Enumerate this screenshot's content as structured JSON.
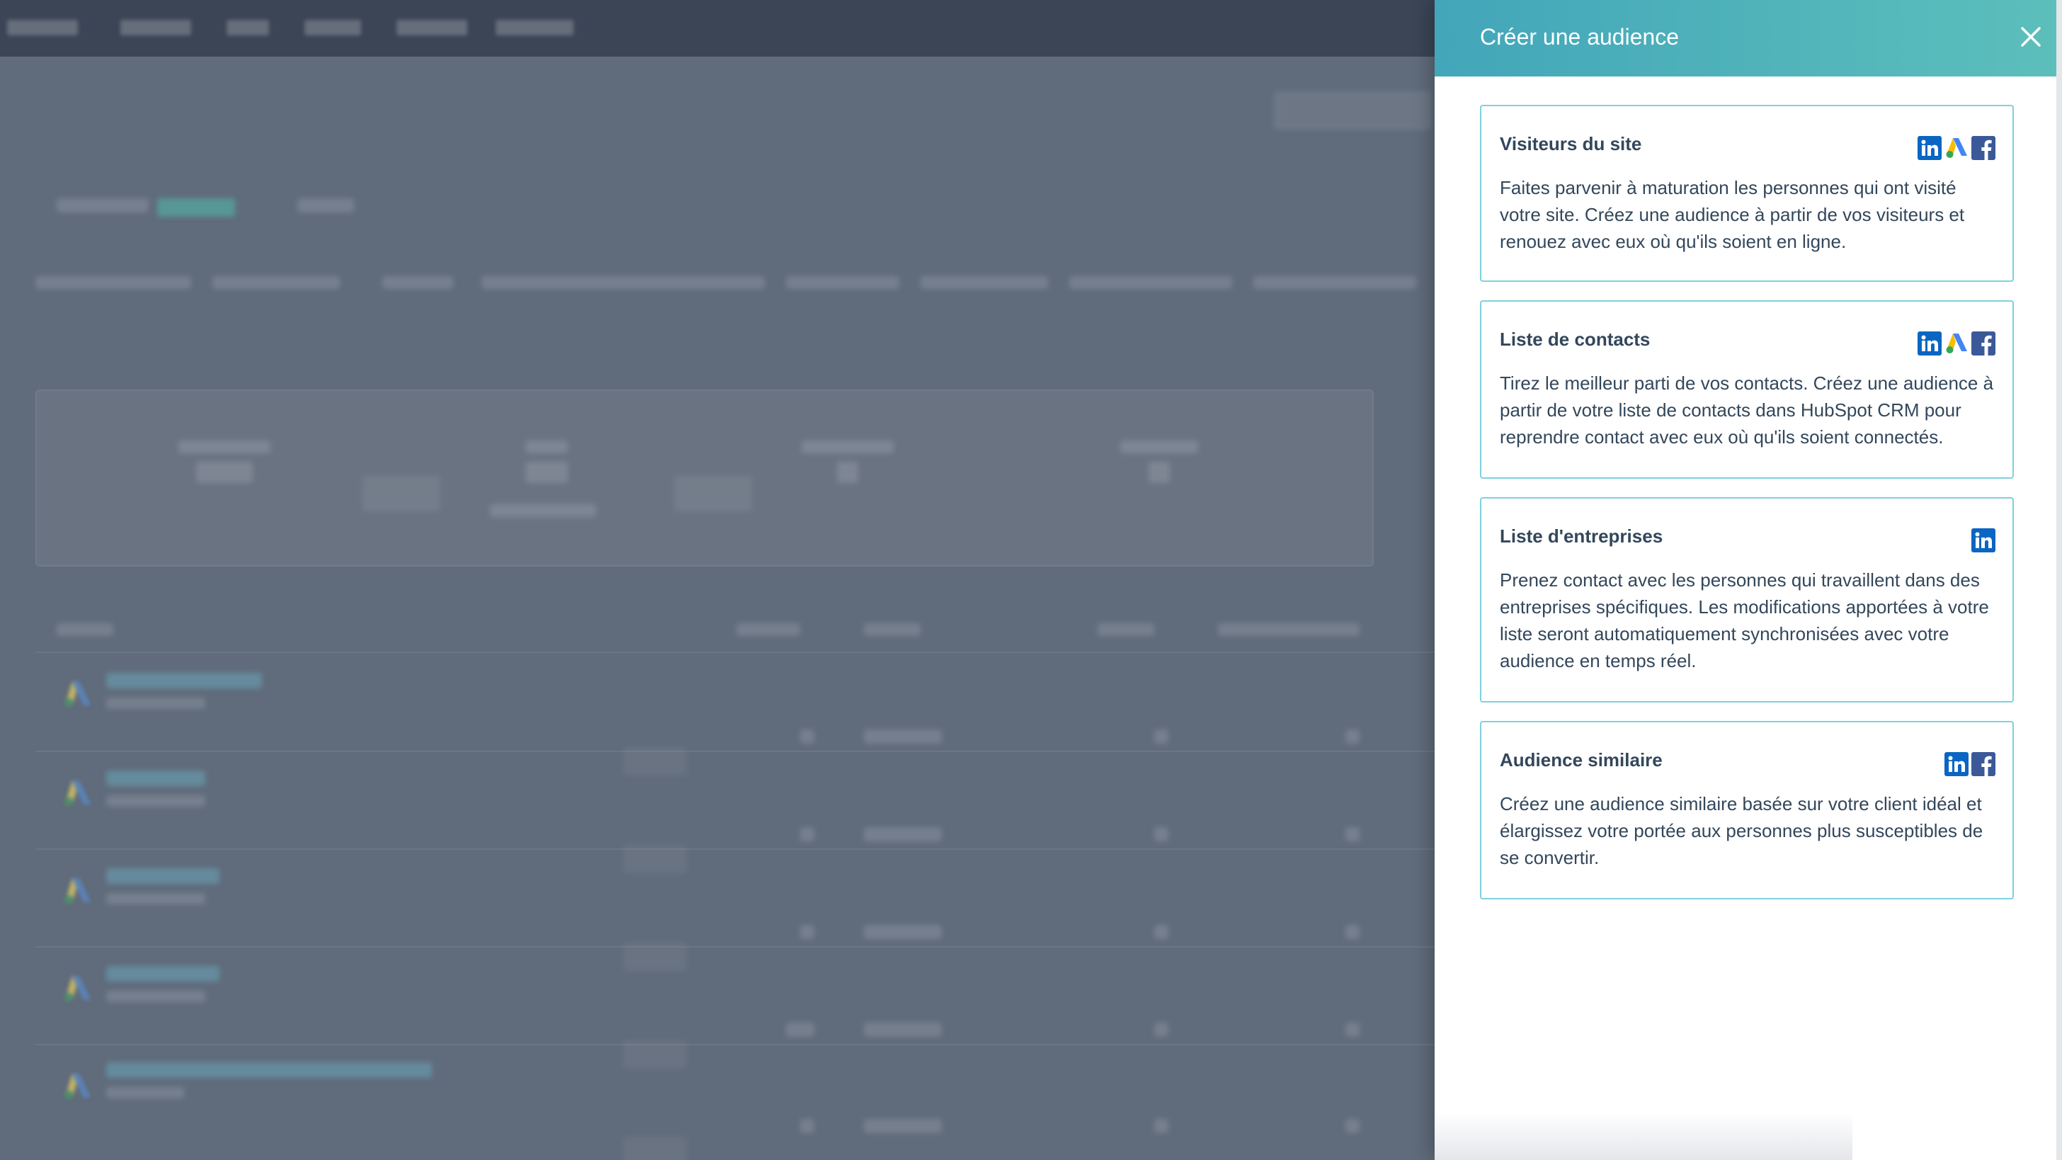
{
  "panel": {
    "title": "Créer une audience",
    "header_gradient": [
      "#43a6ba",
      "#5cbfbb"
    ],
    "accent_border": "#7fd1de",
    "options": [
      {
        "title": "Visiteurs du site",
        "description": "Faites parvenir à maturation les personnes qui ont visité votre site. Créez une audience à partir de vos visiteurs et renouez avec eux où qu'ils soient en ligne.",
        "icons": [
          "linkedin-icon",
          "google-ads-icon",
          "facebook-icon"
        ]
      },
      {
        "title": "Liste de contacts",
        "description": "Tirez le meilleur parti de vos contacts. Créez une audience à partir de votre liste de contacts dans HubSpot CRM pour reprendre contact avec eux où qu'ils soient connectés.",
        "icons": [
          "linkedin-icon",
          "google-ads-icon",
          "facebook-icon"
        ]
      },
      {
        "title": "Liste d'entreprises",
        "description": "Prenez contact avec les personnes qui travaillent dans des entreprises spécifiques. Les modifications apportées à votre liste seront automatiquement synchronisées avec votre audience en temps réel.",
        "icons": [
          "linkedin-icon"
        ]
      },
      {
        "title": "Audience similaire",
        "description": "Créez une audience similaire basée sur votre client idéal et élargissez votre portée aux personnes plus susceptibles de se convertir.",
        "icons": [
          "linkedin-icon",
          "facebook-icon"
        ]
      }
    ]
  },
  "colors": {
    "linkedin": "#0a66c2",
    "facebook": "#3b5998",
    "text": "#33475b",
    "overlay": "#5f6a7b"
  }
}
